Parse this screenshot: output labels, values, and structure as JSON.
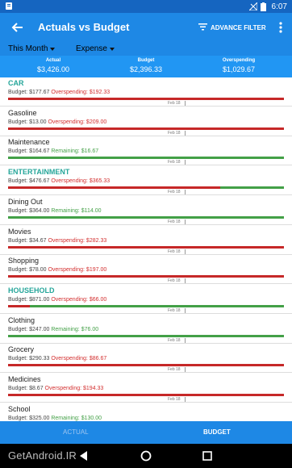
{
  "status_bar": {
    "time": "6:07"
  },
  "app_bar": {
    "title": "Actuals vs Budget",
    "filter_label": "ADVANCE FILTER"
  },
  "filters": {
    "period": "This Month",
    "type": "Expense"
  },
  "summary": [
    {
      "label": "Actual",
      "value": "$3,426.00"
    },
    {
      "label": "Budget",
      "value": "$2,396.33"
    },
    {
      "label": "Overspending",
      "value": "$1,029.67"
    }
  ],
  "rows": [
    {
      "name": "CAR",
      "category": true,
      "budget": "Budget: $177.67",
      "status": "Overspending: $192.33",
      "over": true,
      "fill": 1.0,
      "date": "Feb 18"
    },
    {
      "name": "Gasoline",
      "category": false,
      "budget": "Budget: $13.00",
      "status": "Overspending: $209.00",
      "over": true,
      "fill": 1.0,
      "date": "Feb 18"
    },
    {
      "name": "Maintenance",
      "category": false,
      "budget": "Budget: $164.67",
      "status": "Remaining: $16.67",
      "over": false,
      "fill": 0.0,
      "date": "Feb 18"
    },
    {
      "name": "ENTERTAINMENT",
      "category": true,
      "budget": "Budget: $476.67",
      "status": "Overspending: $365.33",
      "over": true,
      "fill": 0.77,
      "date": "Feb 18"
    },
    {
      "name": "Dining Out",
      "category": false,
      "budget": "Budget: $364.00",
      "status": "Remaining: $114.00",
      "over": false,
      "fill": 0.0,
      "date": "Feb 18"
    },
    {
      "name": "Movies",
      "category": false,
      "budget": "Budget: $34.67",
      "status": "Overspending: $282.33",
      "over": true,
      "fill": 1.0,
      "date": "Feb 18"
    },
    {
      "name": "Shopping",
      "category": false,
      "budget": "Budget: $78.00",
      "status": "Overspending: $197.00",
      "over": true,
      "fill": 1.0,
      "date": "Feb 18"
    },
    {
      "name": "HOUSEHOLD",
      "category": true,
      "budget": "Budget: $871.00",
      "status": "Overspending: $66.00",
      "over": true,
      "fill": 0.08,
      "date": "Feb 18"
    },
    {
      "name": "Clothing",
      "category": false,
      "budget": "Budget: $247.00",
      "status": "Remaining: $76.00",
      "over": false,
      "fill": 0.0,
      "date": "Feb 18"
    },
    {
      "name": "Grocery",
      "category": false,
      "budget": "Budget: $290.33",
      "status": "Overspending: $86.67",
      "over": true,
      "fill": 1.0,
      "date": "Feb 18"
    },
    {
      "name": "Medicines",
      "category": false,
      "budget": "Budget: $8.67",
      "status": "Overspending: $194.33",
      "over": true,
      "fill": 1.0,
      "date": "Feb 18"
    },
    {
      "name": "School",
      "category": false,
      "budget": "Budget: $325.00",
      "status": "Remaining: $130.00",
      "over": false,
      "fill": 0.0,
      "date": "Feb 18"
    }
  ],
  "tabs": {
    "actual": "ACTUAL",
    "budget": "BUDGET"
  },
  "watermark": "GetAndroid.IR",
  "colors": {
    "primary": "#1e88e5",
    "category": "#26a69a",
    "over": "#c62828",
    "remaining": "#43a047"
  }
}
